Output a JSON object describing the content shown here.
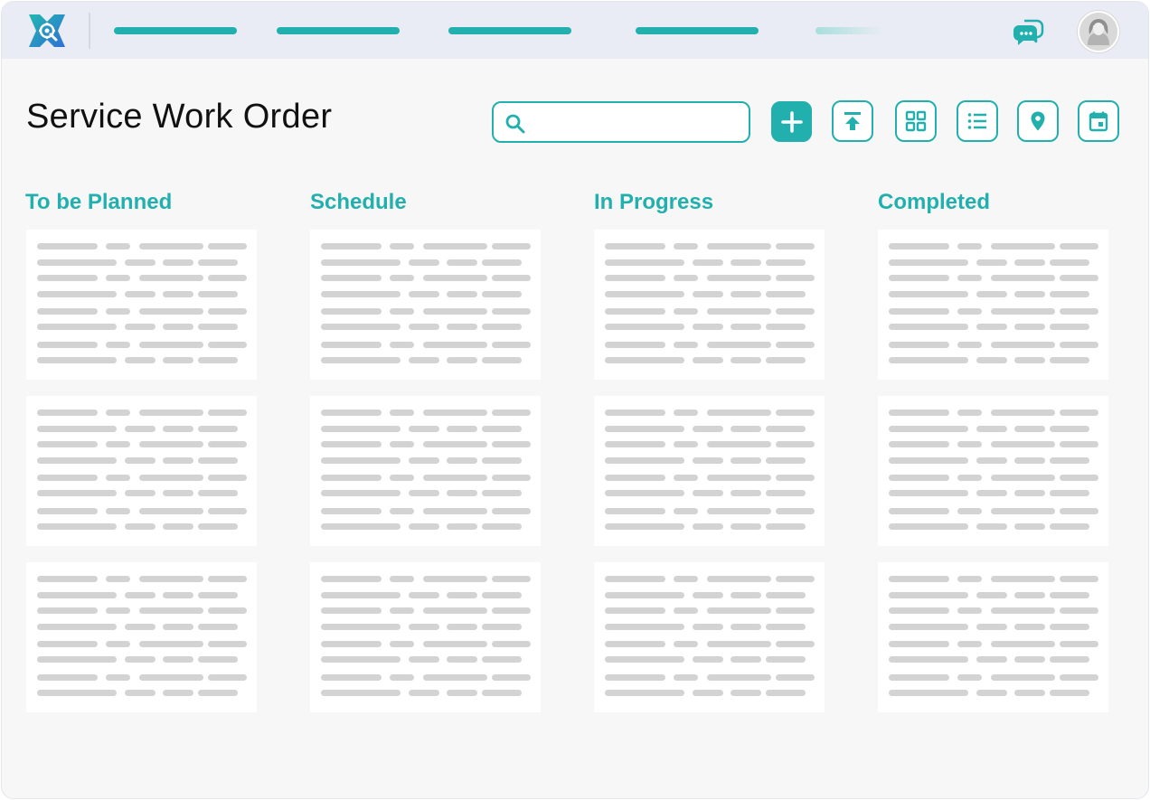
{
  "brand": {
    "accent": "#21b0ad",
    "logo_icon": "gear-wrench-logo-icon"
  },
  "topbar": {
    "nav_items": 5,
    "chat_icon": "chat-bubbles-icon",
    "avatar_icon": "user-avatar-icon"
  },
  "page": {
    "title": "Service Work Order"
  },
  "search": {
    "placeholder": "",
    "value": "",
    "icon": "search-icon"
  },
  "toolbar": {
    "buttons": [
      {
        "name": "add-button",
        "icon": "plus-icon"
      },
      {
        "name": "upload-button",
        "icon": "upload-icon"
      },
      {
        "name": "grid-view-button",
        "icon": "grid-icon"
      },
      {
        "name": "list-view-button",
        "icon": "list-icon"
      },
      {
        "name": "map-view-button",
        "icon": "location-pin-icon"
      },
      {
        "name": "calendar-view-button",
        "icon": "calendar-icon"
      }
    ]
  },
  "board": {
    "columns": [
      {
        "title": "To be Planned",
        "cards": 3
      },
      {
        "title": "Schedule",
        "cards": 3
      },
      {
        "title": "In Progress",
        "cards": 3
      },
      {
        "title": "Completed",
        "cards": 3
      }
    ]
  }
}
